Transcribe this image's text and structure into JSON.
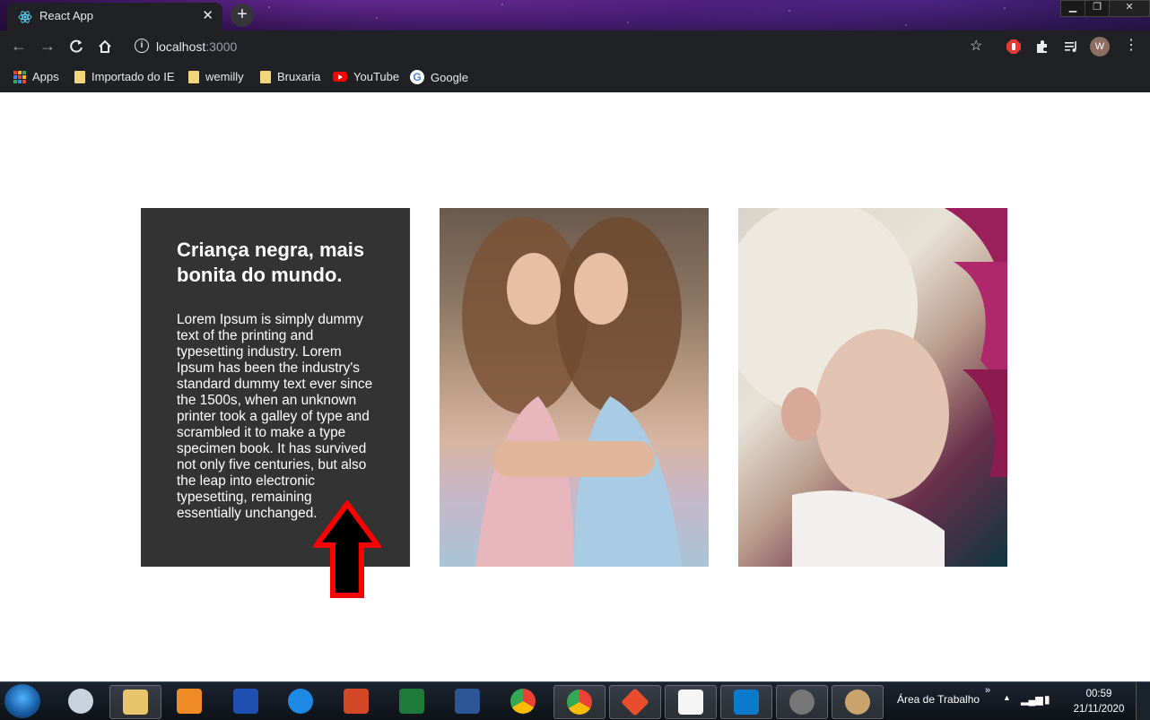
{
  "browser": {
    "tab_title": "React App",
    "tab_close": "✕",
    "new_tab": "+",
    "url_host": "localhost",
    "url_port": ":3000",
    "window_buttons": {
      "minimize": "▁",
      "restore": "❐",
      "close": "✕"
    },
    "avatar_letter": "W",
    "bookmarks": [
      {
        "label": "Apps",
        "icon": "apps-grid-icon"
      },
      {
        "label": "Importado do IE",
        "icon": "folder-icon"
      },
      {
        "label": "wemilly",
        "icon": "folder-icon"
      },
      {
        "label": "Bruxaria",
        "icon": "folder-icon"
      },
      {
        "label": "YouTube",
        "icon": "youtube-icon"
      },
      {
        "label": "Google",
        "icon": "google-icon"
      }
    ]
  },
  "page": {
    "card_title": "Criança negra, mais bonita do mundo.",
    "card_text": "Lorem Ipsum is simply dummy text of the printing and typesetting industry. Lorem Ipsum has been the industry's standard dummy text ever since the 1500s, when an unknown printer took a galley of type and scrambled it to make a type specimen book. It has survived not only five centuries, but also the leap into electronic typesetting, remaining essentially unchanged.",
    "images": [
      {
        "subject": "twin girls hugging photo"
      },
      {
        "subject": "albino girl with orchids photo"
      }
    ],
    "annotation_color": "#ff0000"
  },
  "taskbar": {
    "desktop_label": "Área de Trabalho",
    "time": "00:59",
    "date": "21/11/2020"
  }
}
